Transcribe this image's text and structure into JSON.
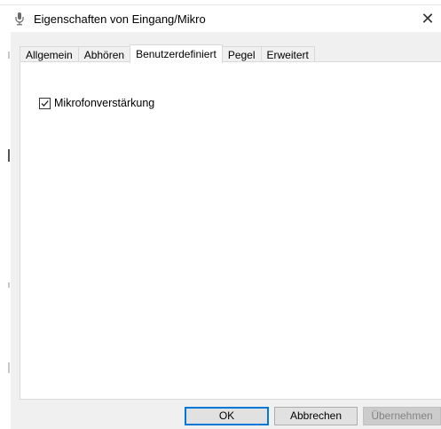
{
  "window": {
    "title": "Eigenschaften von Eingang/Mikro",
    "close_glyph": "✕",
    "icon": "microphone-icon"
  },
  "tabs": [
    {
      "label": "Allgemein",
      "active": false
    },
    {
      "label": "Abhören",
      "active": false
    },
    {
      "label": "Benutzerdefiniert",
      "active": true
    },
    {
      "label": "Pegel",
      "active": false
    },
    {
      "label": "Erweitert",
      "active": false
    }
  ],
  "custom_page": {
    "mic_boost": {
      "label": "Mikrofonverstärkung",
      "checked": true
    }
  },
  "buttons": {
    "ok": "OK",
    "cancel": "Abbrechen",
    "apply": "Übernehmen"
  },
  "colors": {
    "accent": "#0078d7",
    "panel": "#f0f0f0",
    "disabled_text": "#838383"
  }
}
